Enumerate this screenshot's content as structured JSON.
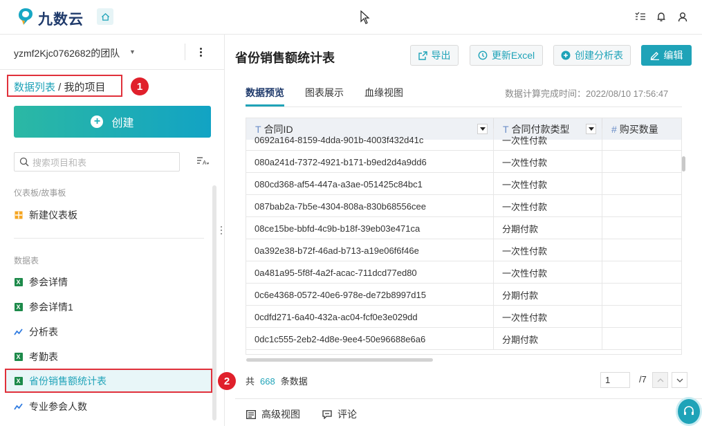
{
  "app": {
    "logo_text": "九数云"
  },
  "sidebar": {
    "team_name": "yzmf2Kjc0762682的团队",
    "breadcrumb": {
      "link": "数据列表",
      "sep": " / ",
      "current": "我的项目"
    },
    "create_label": "创建",
    "search_placeholder": "搜索项目和表",
    "groups": [
      {
        "label": "仪表板/故事板"
      },
      {
        "label": "数据表"
      }
    ],
    "dashboards": [
      {
        "label": "新建仪表板",
        "icon": "dashboard-icon"
      }
    ],
    "tables": [
      {
        "label": "参会详情",
        "icon": "excel-icon"
      },
      {
        "label": "参会详情1",
        "icon": "excel-icon"
      },
      {
        "label": "分析表",
        "icon": "analysis-icon"
      },
      {
        "label": "考勤表",
        "icon": "excel-icon"
      },
      {
        "label": "省份销售额统计表",
        "icon": "excel-icon"
      },
      {
        "label": "专业参会人数",
        "icon": "analysis-icon"
      }
    ],
    "badges": [
      "1",
      "2"
    ]
  },
  "main": {
    "title": "省份销售额统计表",
    "toolbar": {
      "export": "导出",
      "update_excel": "更新Excel",
      "create_analysis": "创建分析表",
      "edit": "编辑"
    },
    "tabs": [
      "数据预览",
      "图表展示",
      "血缘视图"
    ],
    "calc_time": "数据计算完成时间：2022/08/10 17:56:47",
    "table": {
      "columns": [
        {
          "label": "合同ID",
          "type": "T"
        },
        {
          "label": "合同付款类型",
          "type": "T"
        },
        {
          "label": "购买数量",
          "type": "#"
        }
      ],
      "rows": [
        [
          "0692a164-8159-4dda-901b-4003f432d41c",
          "一次性付款",
          ""
        ],
        [
          "080a241d-7372-4921-b171-b9ed2d4a9dd6",
          "一次性付款",
          ""
        ],
        [
          "080cd368-af54-447a-a3ae-051425c84bc1",
          "一次性付款",
          ""
        ],
        [
          "087bab2a-7b5e-4304-808a-830b68556cee",
          "一次性付款",
          ""
        ],
        [
          "08ce15be-bbfd-4c9b-b18f-39eb03e471ca",
          "分期付款",
          ""
        ],
        [
          "0a392e38-b72f-46ad-b713-a19e06f6f46e",
          "一次性付款",
          ""
        ],
        [
          "0a481a95-5f8f-4a2f-acac-711dcd77ed80",
          "一次性付款",
          ""
        ],
        [
          "0c6e4368-0572-40e6-978e-de72b8997d15",
          "分期付款",
          ""
        ],
        [
          "0cdfd271-6a40-432a-ac04-fcf0e3e029dd",
          "一次性付款",
          ""
        ],
        [
          "0dc1c555-2eb2-4d8e-9ee4-50e96688e6a6",
          "分期付款",
          ""
        ]
      ]
    },
    "footer": {
      "count_prefix": "共",
      "count": "668",
      "count_suffix": "条数据",
      "page_current": "1",
      "page_total": "/7"
    },
    "bottom_tabs": {
      "advanced": "高级视图",
      "comment": "评论"
    }
  },
  "colors": {
    "accent": "#1fa3b8",
    "highlight": "#e0303a"
  }
}
